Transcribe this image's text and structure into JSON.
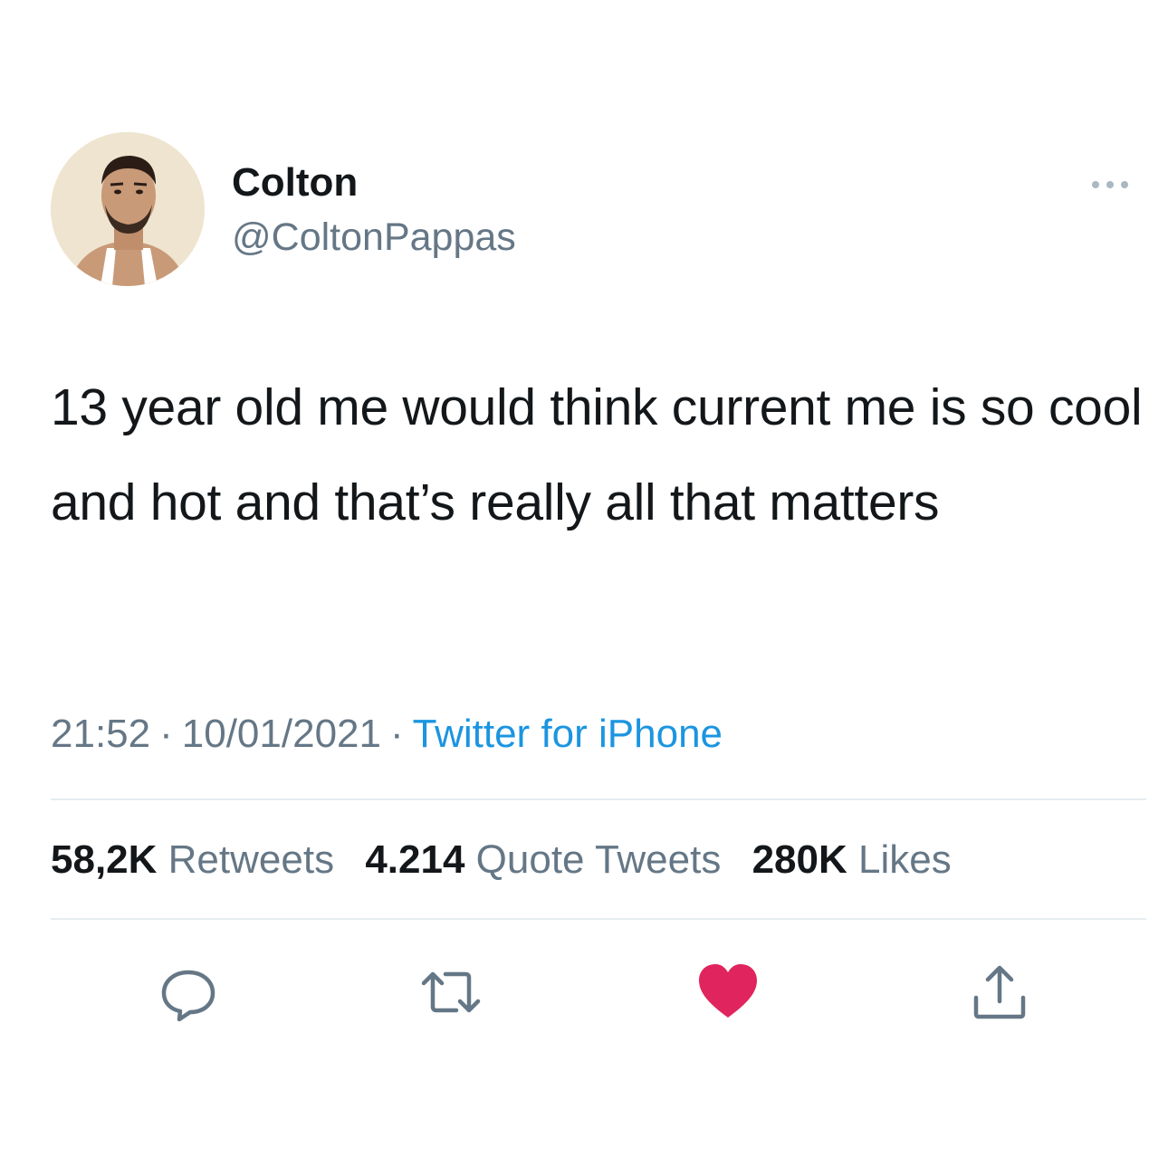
{
  "tweet": {
    "author": {
      "display_name": "Colton",
      "handle": "@ColtonPappas"
    },
    "text": "13 year old me would think current me is so cool and hot and that’s really all that matters",
    "time": "21:52",
    "date": "10/01/2021",
    "source": "Twitter for iPhone",
    "separator": "·",
    "stats": {
      "retweets_count": "58,2K",
      "retweets_label": "Retweets",
      "quotes_count": "4.214",
      "quotes_label": "Quote Tweets",
      "likes_count": "280K",
      "likes_label": "Likes"
    },
    "actions": [
      "reply-icon",
      "retweet-icon",
      "like-icon",
      "share-icon"
    ],
    "more_icon": "more-options-icon"
  },
  "colors": {
    "text": "#14171a",
    "secondary": "#657786",
    "link": "#1b95e0",
    "like": "#e0245e",
    "divider": "#e6ecf0"
  }
}
